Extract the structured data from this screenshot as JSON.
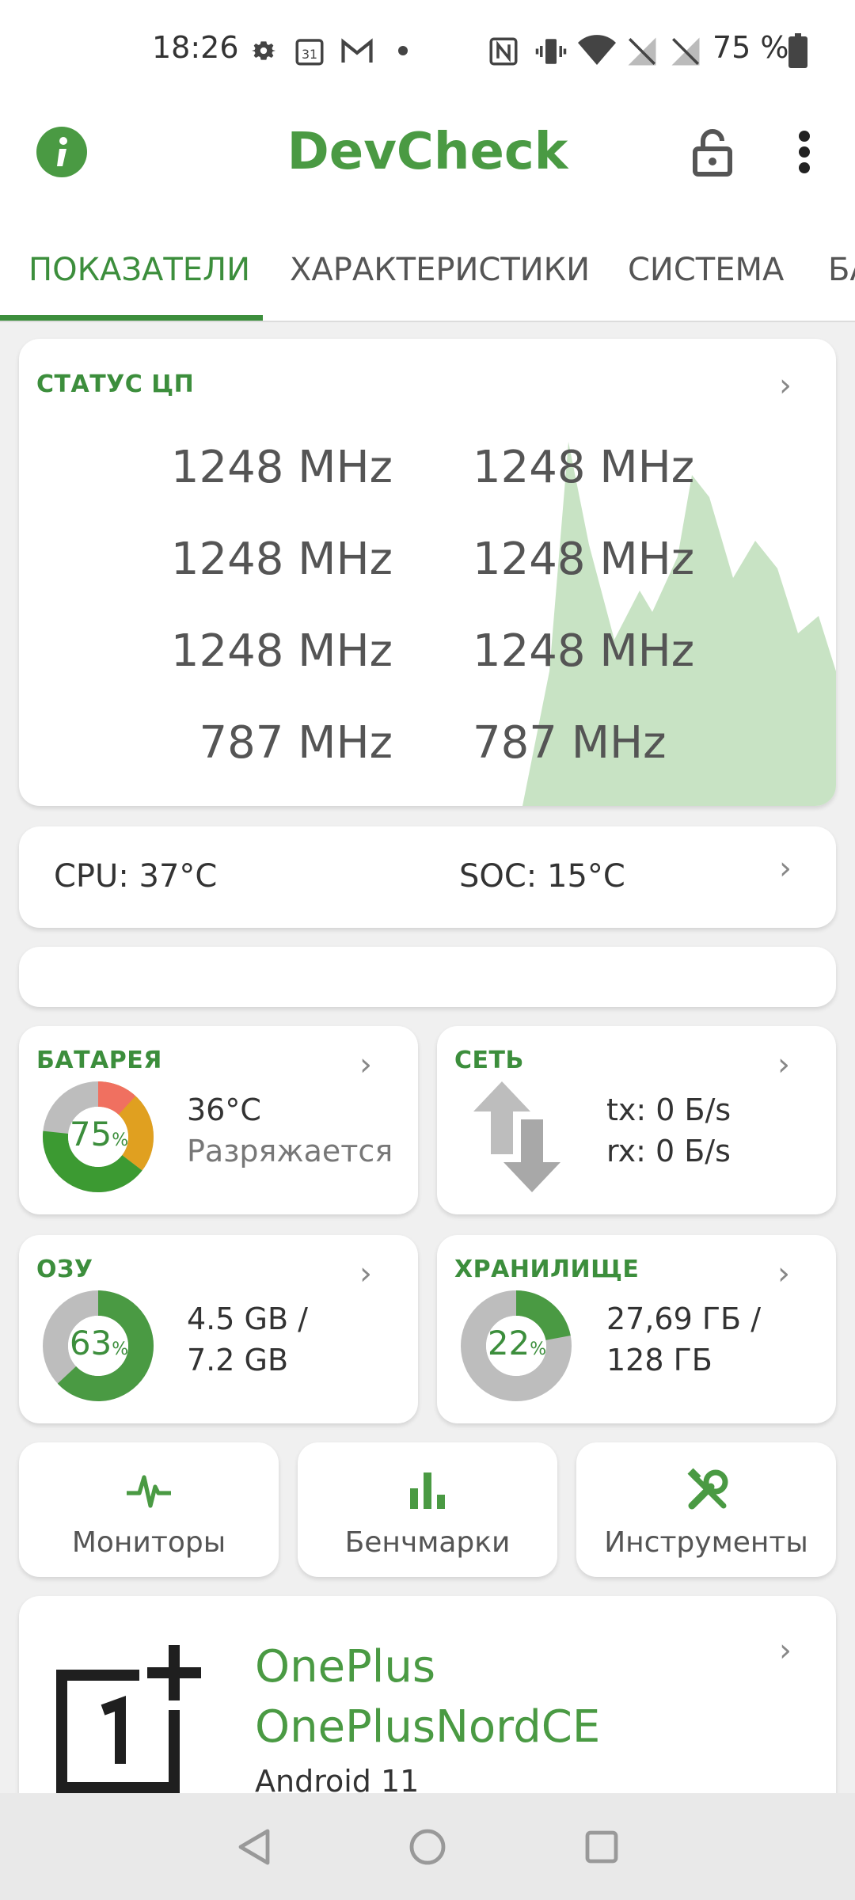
{
  "status_bar": {
    "time": "18:26",
    "battery": "75 %"
  },
  "app_bar": {
    "title": "DevCheck"
  },
  "tabs": [
    {
      "label": "ПОКАЗАТЕЛИ"
    },
    {
      "label": "ХАРАКТЕРИСТИКИ"
    },
    {
      "label": "СИСТЕМА"
    },
    {
      "label": "БА"
    }
  ],
  "cpu": {
    "label": "СТАТУС ЦП",
    "freqs": [
      "1248 MHz",
      "1248 MHz",
      "1248 MHz",
      "1248 MHz",
      "1248 MHz",
      "1248 MHz",
      "787 MHz",
      "787 MHz"
    ],
    "chart_color": "#c8e3c4"
  },
  "temps": {
    "cpu": "CPU: 37°C",
    "soc": "SOC: 15°C"
  },
  "battery": {
    "label": "БАТАРЕЯ",
    "percent": "75",
    "percent_value": 75,
    "temp": "36°C",
    "state": "Разряжается"
  },
  "network": {
    "label": "СЕТЬ",
    "tx": "tx: 0 Б/s",
    "rx": "rx: 0 Б/s"
  },
  "ram": {
    "label": "ОЗУ",
    "percent": "63",
    "percent_value": 63,
    "line1": "4.5 GB /",
    "line2": "7.2 GB"
  },
  "storage": {
    "label": "ХРАНИЛИЩЕ",
    "percent": "22",
    "percent_value": 22,
    "line1": "27,69 ГБ /",
    "line2": "128 ГБ"
  },
  "shortcuts": [
    {
      "label": "Мониторы",
      "icon": "pulse-icon"
    },
    {
      "label": "Бенчмарки",
      "icon": "bar-chart-icon"
    },
    {
      "label": "Инструменты",
      "icon": "tools-icon"
    }
  ],
  "device": {
    "brand": "OnePlus",
    "model": "OnePlusNordCE",
    "os": "Android 11"
  },
  "colors": {
    "accent": "#3c8e3c",
    "title_green": "#4a9a43",
    "gauge_bg": "#bdbdbd"
  }
}
